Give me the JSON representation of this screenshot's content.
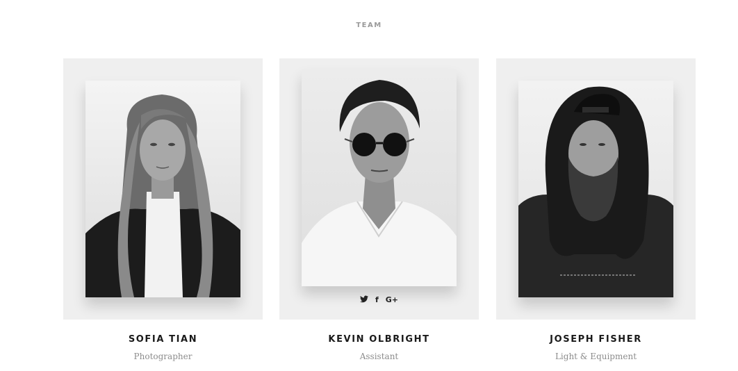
{
  "section": {
    "title": "TEAM"
  },
  "members": [
    {
      "name": "SOFIA TIAN",
      "role": "Photographer",
      "photo_icon": "portrait-photo"
    },
    {
      "name": "KEVIN OLBRIGHT",
      "role": "Assistant",
      "photo_icon": "portrait-photo",
      "social": [
        "twitter-icon",
        "facebook-icon",
        "google-plus-icon"
      ],
      "social_labels": {
        "facebook": "f",
        "google_plus": "G+"
      }
    },
    {
      "name": "JOSEPH FISHER",
      "role": "Light & Equipment",
      "photo_icon": "portrait-photo"
    }
  ],
  "colors": {
    "card_background": "#efefef",
    "title_color": "#9a9a9a",
    "name_color": "#1a1a1a",
    "role_color": "#8c8c8c"
  }
}
